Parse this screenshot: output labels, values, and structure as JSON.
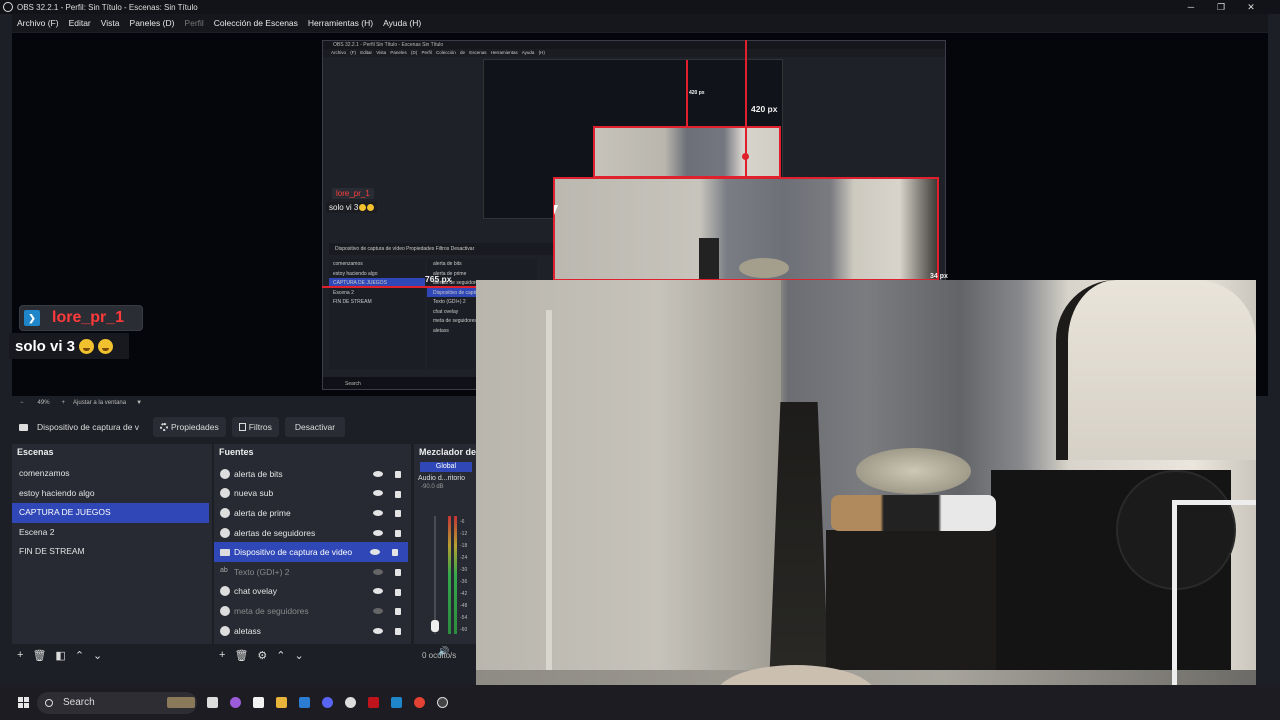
{
  "window": {
    "title": "OBS 32.2.1 - Perfil: Sin Título - Escenas: Sin Título",
    "minimize": "─",
    "maximize": "❐",
    "close": "✕"
  },
  "menu": {
    "archivo": "Archivo (F)",
    "editar": "Editar",
    "vista": "Vista",
    "paneles": "Paneles (D)",
    "perfil": "Perfil",
    "coleccion": "Colección de Escenas",
    "herramientas": "Herramientas (H)",
    "ayuda": "Ayuda (H)"
  },
  "preview": {
    "px_top": "420 px",
    "px_left": "765 px",
    "px_right": "34 px",
    "px_nested": "420 px",
    "nested_title": "OBS 32.2.1 - Perfil Sin Título - Escenas Sin Título",
    "nested_menu": "Archivo (F) Editar Vista Paneles (D) Perfil Colección de Escenas Herramientas Ayuda (H)",
    "nested_header": "Dispositivo de captura de vídeo   Propiedades   Filtros   Desactivar",
    "nested_scenes": [
      "comenzamos",
      "estoy haciendo algo",
      "CAPTURA DE JUEGOS",
      "Escena 2",
      "FIN DE STREAM"
    ],
    "nested_sources": [
      "alerta de bits",
      "alerta de prime",
      "alertas de seguidores",
      "Dispositivo de captura",
      "Texto (GDI+) 2",
      "chat ovelay",
      "meta de seguidores",
      "aletass"
    ],
    "nested_search": "Search"
  },
  "chat": {
    "username": "lore_pr_1",
    "message": "solo vi 3",
    "small_username": "lore_pr_1",
    "small_message": "solo vi 3"
  },
  "zoom": {
    "minus": "−",
    "value": "49%",
    "plus": "+",
    "fit": "Ajustar a la ventana"
  },
  "source_toolbar": {
    "name": "Dispositivo de captura de v",
    "properties": "Propiedades",
    "filters": "Filtros",
    "deactivate": "Desactivar"
  },
  "scenes": {
    "header": "Escenas",
    "items": [
      "comenzamos",
      "estoy haciendo algo",
      "CAPTURA DE JUEGOS",
      "Escena 2",
      "FIN DE STREAM"
    ],
    "selected_index": 2
  },
  "sources": {
    "header": "Fuentes",
    "items": [
      {
        "label": "alerta de bits",
        "icon": "browser-icon",
        "visible": true,
        "dim": false
      },
      {
        "label": "nueva sub",
        "icon": "browser-icon",
        "visible": true,
        "dim": false
      },
      {
        "label": "alerta de prime",
        "icon": "browser-icon",
        "visible": true,
        "dim": false
      },
      {
        "label": "alertas de seguidores",
        "icon": "browser-icon",
        "visible": true,
        "dim": false
      },
      {
        "label": "Dispositivo de captura de video",
        "icon": "camera-icon",
        "visible": true,
        "dim": false,
        "selected": true
      },
      {
        "label": "Texto (GDI+) 2",
        "icon": "text-icon",
        "visible": false,
        "dim": true
      },
      {
        "label": "chat ovelay",
        "icon": "browser-icon",
        "visible": true,
        "dim": false
      },
      {
        "label": "meta de seguidores",
        "icon": "browser-icon",
        "visible": false,
        "dim": true
      },
      {
        "label": "aletass",
        "icon": "browser-icon",
        "visible": true,
        "dim": false
      }
    ]
  },
  "mixer": {
    "header": "Mezclador de",
    "tab": "Global",
    "channel": "Audio d...ritorio",
    "level": "-90.0 dB",
    "ticks": [
      "-6",
      "-12",
      "-18",
      "-24",
      "-30",
      "-36",
      "-42",
      "-48",
      "-54",
      "-60"
    ],
    "hidden": "0 oculto/s"
  },
  "taskbar": {
    "search": "Search"
  },
  "colors": {
    "accent": "#2f47b7",
    "guide": "#e0202c",
    "chat_name": "#ff3a3a"
  }
}
